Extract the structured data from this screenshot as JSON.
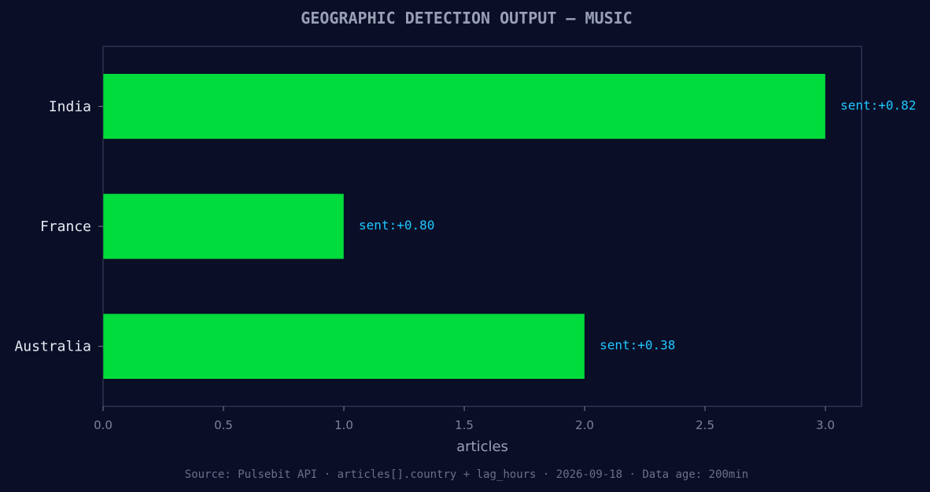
{
  "chart_data": {
    "type": "bar",
    "orientation": "horizontal",
    "title": "GEOGRAPHIC DETECTION OUTPUT — MUSIC",
    "xlabel": "articles",
    "ylabel": "",
    "categories": [
      "India",
      "France",
      "Australia"
    ],
    "values": [
      3,
      1,
      2
    ],
    "annotations": [
      "sent:+0.82",
      "sent:+0.80",
      "sent:+0.38"
    ],
    "xlim": [
      0,
      3.15
    ],
    "xticks": [
      0.0,
      0.5,
      1.0,
      1.5,
      2.0,
      2.5,
      3.0
    ],
    "xtick_labels": [
      "0.0",
      "0.5",
      "1.0",
      "1.5",
      "2.0",
      "2.5",
      "3.0"
    ],
    "grid": false,
    "source": "Source: Pulsebit API · articles[].country + lag_hours · 2026-09-18 · Data age: 200min"
  },
  "colors": {
    "background": "#0a0e27",
    "bar": "#00dc3c",
    "annotation": "#1fc8ff",
    "frame": "#2e3350"
  }
}
